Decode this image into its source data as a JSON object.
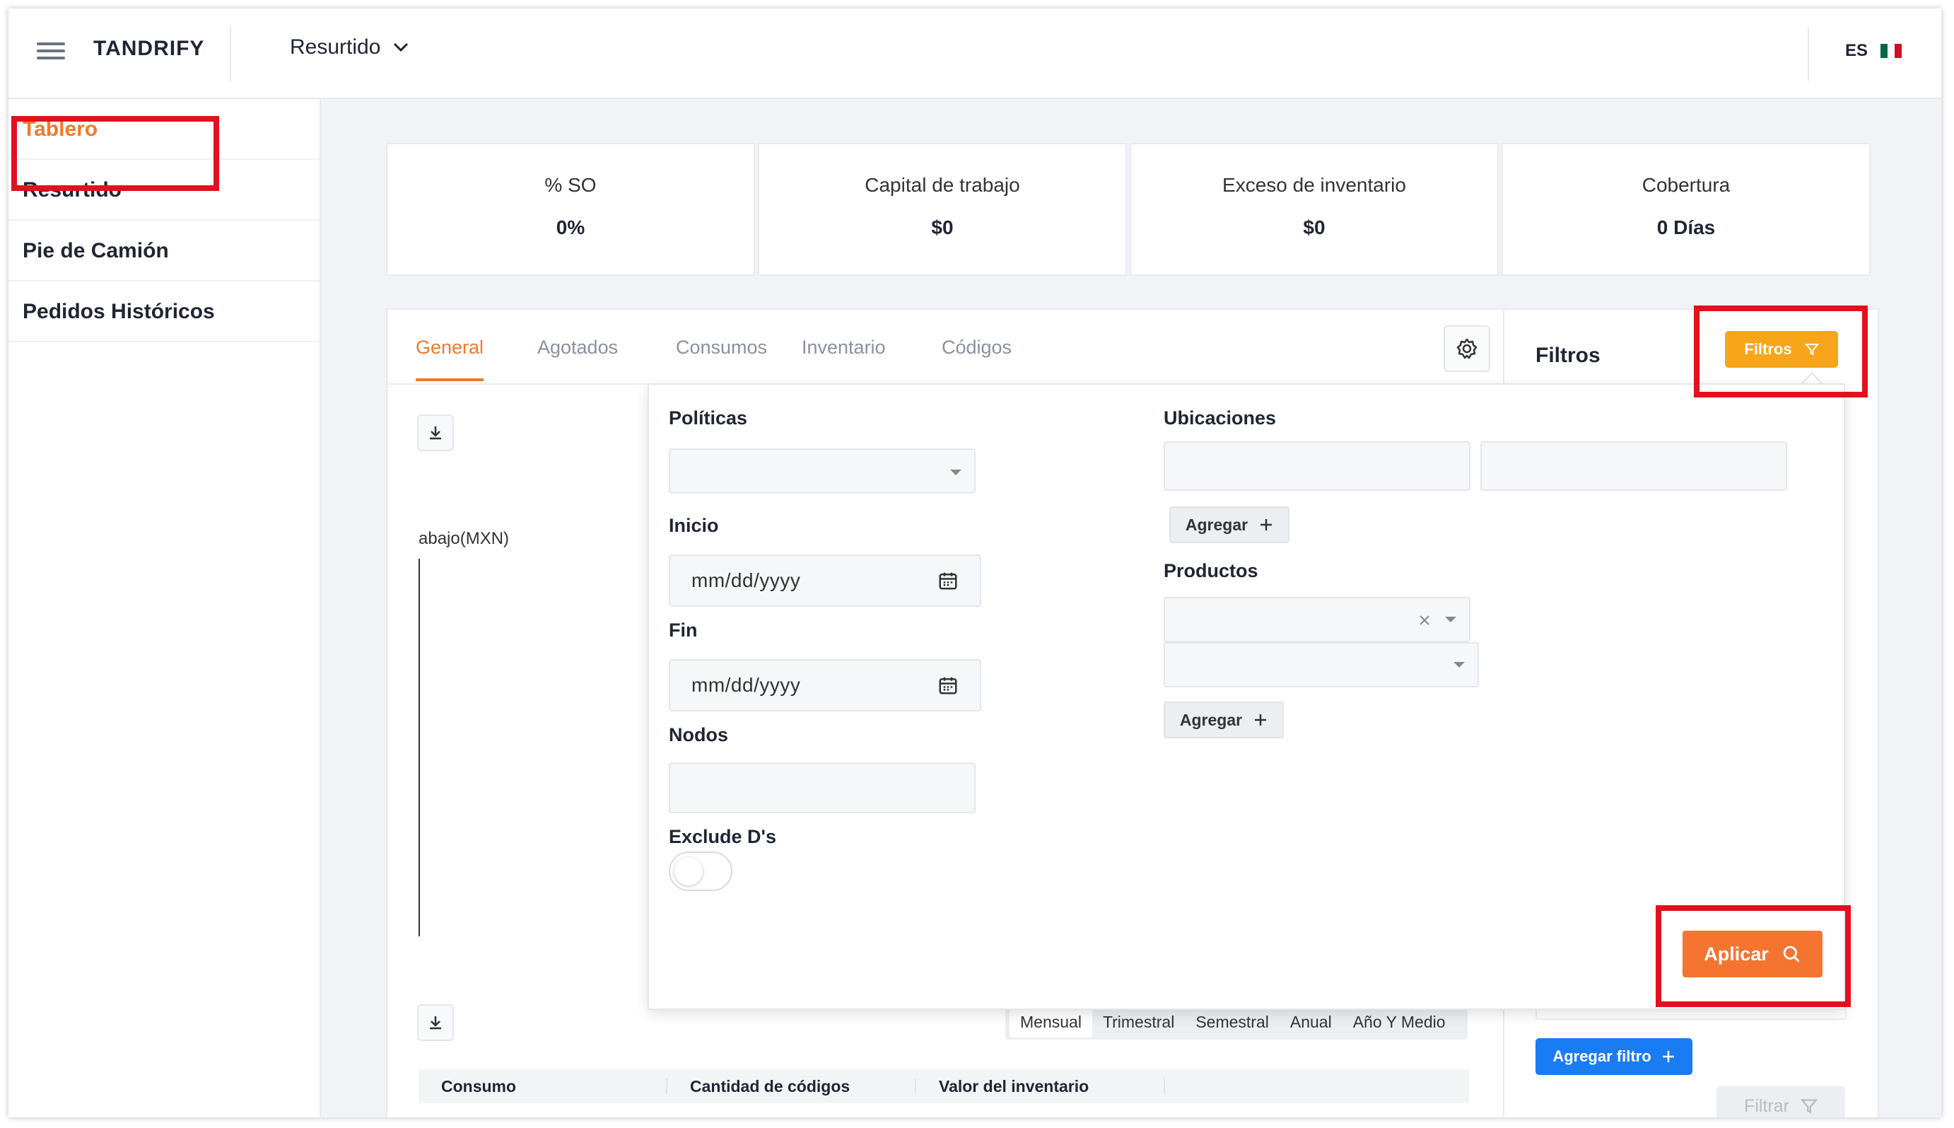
{
  "header": {
    "brand": "TANDRIFY",
    "module": "Resurtido",
    "lang": "ES",
    "flag_colors": [
      "#006847",
      "#ffffff",
      "#ce1126"
    ]
  },
  "sidebar": {
    "items": [
      {
        "label": "Tablero",
        "active": true
      },
      {
        "label": "Resurtido"
      },
      {
        "label": "Pie de Camión"
      },
      {
        "label": "Pedidos Históricos"
      }
    ]
  },
  "kpis": [
    {
      "label": "% SO",
      "value": "0%"
    },
    {
      "label": "Capital de trabajo",
      "value": "$0"
    },
    {
      "label": "Exceso de inventario",
      "value": "$0"
    },
    {
      "label": "Cobertura",
      "value": "0 Días"
    }
  ],
  "tabs": [
    "General",
    "Agotados",
    "Consumos",
    "Inventario",
    "Códigos"
  ],
  "chart": {
    "label": "abajo(MXN)"
  },
  "periods": [
    "Mensual",
    "Trimestral",
    "Semestral",
    "Anual",
    "Año Y Medio"
  ],
  "table": {
    "headers": [
      "Consumo",
      "Cantidad de códigos",
      "Valor del inventario"
    ]
  },
  "filters_panel": {
    "title": "Filtros",
    "filters_button": "Filtros",
    "add_filter": "Agregar filtro",
    "filter_button": "Filtrar"
  },
  "popup": {
    "politicas": "Políticas",
    "inicio": "Inicio",
    "inicio_placeholder": "mm/dd/yyyy",
    "fin": "Fin",
    "fin_placeholder": "mm/dd/yyyy",
    "nodos": "Nodos",
    "exclude": "Exclude D's",
    "ubicaciones": "Ubicaciones",
    "agregar": "Agregar",
    "productos": "Productos",
    "aplicar": "Aplicar"
  },
  "colors": {
    "accent": "#f07a2a",
    "highlight": "#e3101d",
    "filters_btn": "#f7a61a",
    "primary_blue": "#1a7cf3"
  }
}
